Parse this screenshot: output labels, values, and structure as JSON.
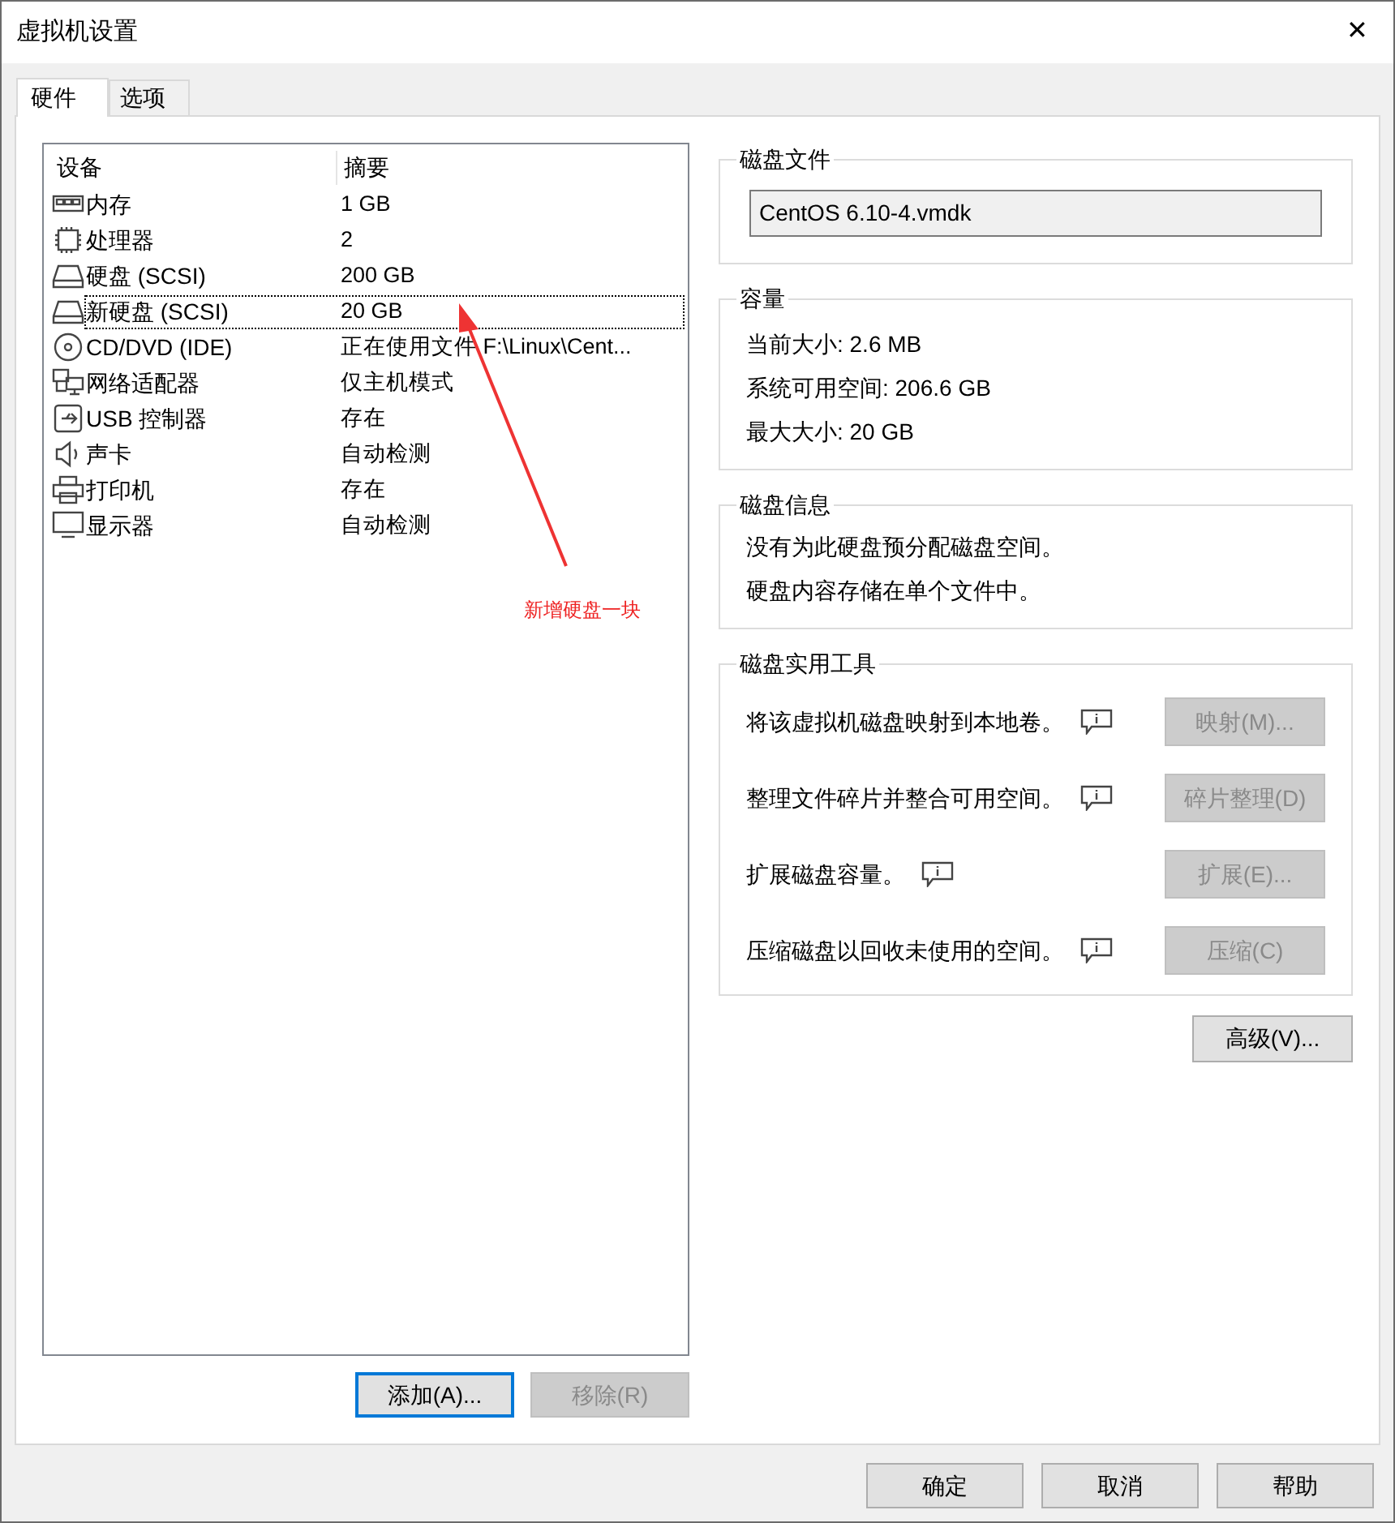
{
  "window": {
    "title": "虚拟机设置",
    "close": "✕"
  },
  "tabs": [
    {
      "label": "硬件",
      "selected": true
    },
    {
      "label": "选项",
      "selected": false
    }
  ],
  "device_list": {
    "columns": [
      "设备",
      "摘要"
    ],
    "rows": [
      {
        "kind": "memory",
        "device": "内存",
        "summary": "1 GB",
        "selected": false
      },
      {
        "kind": "cpu",
        "device": "处理器",
        "summary": "2",
        "selected": false
      },
      {
        "kind": "disk",
        "device": "硬盘 (SCSI)",
        "summary": "200 GB",
        "selected": false
      },
      {
        "kind": "disk",
        "device": "新硬盘 (SCSI)",
        "summary": "20 GB",
        "selected": true
      },
      {
        "kind": "cdrom",
        "device": "CD/DVD (IDE)",
        "summary": "正在使用文件 F:\\Linux\\Cent...",
        "selected": false
      },
      {
        "kind": "network",
        "device": "网络适配器",
        "summary": "仅主机模式",
        "selected": false
      },
      {
        "kind": "usb",
        "device": "USB 控制器",
        "summary": "存在",
        "selected": false
      },
      {
        "kind": "sound",
        "device": "声卡",
        "summary": "自动检测",
        "selected": false
      },
      {
        "kind": "printer",
        "device": "打印机",
        "summary": "存在",
        "selected": false
      },
      {
        "kind": "display",
        "device": "显示器",
        "summary": "自动检测",
        "selected": false
      }
    ]
  },
  "list_buttons": [
    {
      "label": "添加(A)...",
      "disabled": false,
      "focused": true
    },
    {
      "label": "移除(R)",
      "disabled": true,
      "focused": false
    }
  ],
  "annotation": {
    "text": "新增硬盘一块"
  },
  "disk_file": {
    "title": "磁盘文件",
    "value": "CentOS 6.10-4.vmdk"
  },
  "capacity": {
    "title": "容量",
    "lines": [
      "当前大小: 2.6 MB",
      "系统可用空间: 206.6 GB",
      "最大大小: 20 GB"
    ]
  },
  "disk_info": {
    "title": "磁盘信息",
    "lines": [
      "没有为此硬盘预分配磁盘空间。",
      "硬盘内容存储在单个文件中。"
    ]
  },
  "disk_tools": {
    "title": "磁盘实用工具",
    "items": [
      {
        "text": "将该虚拟机磁盘映射到本地卷。",
        "button": "映射(M)...",
        "disabled": true
      },
      {
        "text": "整理文件碎片并整合可用空间。",
        "button": "碎片整理(D)",
        "disabled": true
      },
      {
        "text": "扩展磁盘容量。",
        "button": "扩展(E)...",
        "disabled": true
      },
      {
        "text": "压缩磁盘以回收未使用的空间。",
        "button": "压缩(C)",
        "disabled": true
      }
    ]
  },
  "advanced_button": "高级(V)...",
  "dialog_buttons": [
    "确定",
    "取消",
    "帮助"
  ]
}
